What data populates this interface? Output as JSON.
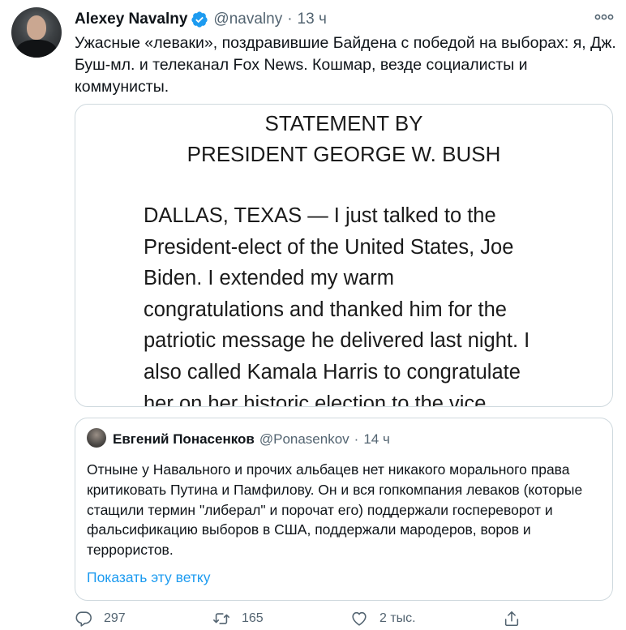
{
  "tweet": {
    "author_name": "Alexey Navalny",
    "author_handle": "@navalny",
    "separator": "·",
    "time": "13 ч",
    "text": "Ужасные «леваки», поздравившие Байдена с победой на выборах: я, Дж. Буш-мл. и телеканал Fox News. Кошмар, везде социалисты и коммунисты.",
    "media": {
      "title_line1": "STATEMENT BY",
      "title_line2": "PRESIDENT GEORGE W. BUSH",
      "body": "DALLAS, TEXAS — I just talked to the\nPresident-elect of the United States, Joe\nBiden. I extended my warm\ncongratulations and thanked him for the\npatriotic message he delivered last night. I\nalso called Kamala Harris to congratulate\nher on her historic election to the vice"
    }
  },
  "quote": {
    "author_name": "Евгений Понасенков",
    "author_handle": "@Ponasenkov",
    "separator": "·",
    "time": "14 ч",
    "text": "Отныне у Навального и прочих альбацев нет никакого морального права критиковать Путина и Памфилову. Он и вся гопкомпания леваков (которые стащили термин \"либерал\" и порочат его) поддержали госпереворот и фальсификацию выборов в США, поддержали мародеров, воров и террористов.",
    "show_thread": "Показать эту ветку"
  },
  "actions": {
    "replies": "297",
    "retweets": "165",
    "likes": "2 тыс."
  },
  "colors": {
    "accent": "#1d9bf0",
    "secondary_text": "#536471",
    "border": "#cfd9de"
  },
  "icons": [
    "more-icon",
    "verified-icon",
    "reply-icon",
    "retweet-icon",
    "like-icon",
    "share-icon"
  ]
}
